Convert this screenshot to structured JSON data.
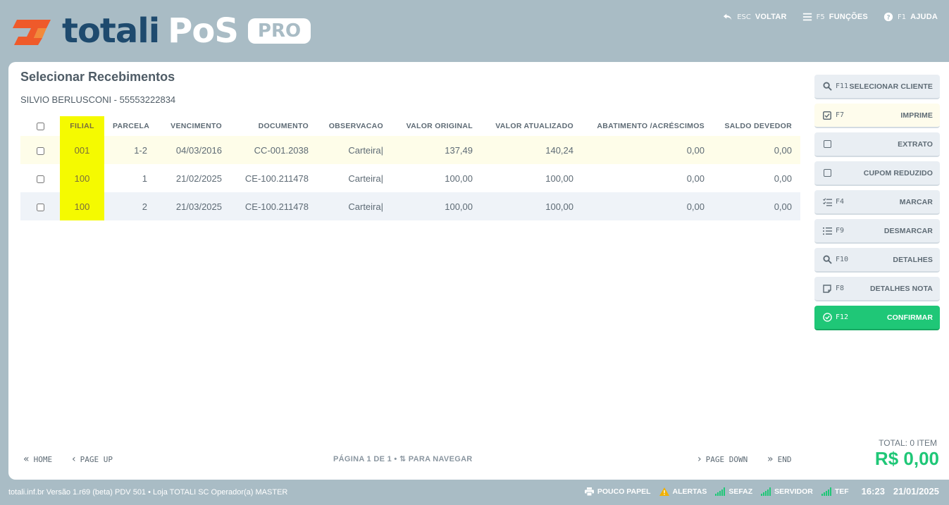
{
  "header": {
    "brand_part1": "totali",
    "brand_part2": "PoS",
    "brand_badge": "PRO",
    "actions": [
      {
        "key": "ESC",
        "label": "VOLTAR",
        "icon": "undo-icon"
      },
      {
        "key": "F5",
        "label": "FUNÇÕES",
        "icon": "menu-icon"
      },
      {
        "key": "F1",
        "label": "AJUDA",
        "icon": "help-icon"
      }
    ],
    "colors": {
      "brand_dark": "#1e4a6e",
      "brand_orange": "#ef5a2a",
      "background": "#a9bcc5"
    }
  },
  "main": {
    "title": "Selecionar Recebimentos",
    "customer": "SILVIO BERLUSCONI - 55553222834",
    "table": {
      "headers": [
        "FILIAL",
        "PARCELA",
        "VENCIMENTO",
        "DOCUMENTO",
        "OBSERVACAO",
        "VALOR ORIGINAL",
        "VALOR ATUALIZADO",
        "ABATIMENTO /ACRÉSCIMOS",
        "SALDO DEVEDOR"
      ],
      "rows": [
        {
          "filial": "001",
          "parcela": "1-2",
          "vencimento": "04/03/2016",
          "documento": "CC-001.2038",
          "observacao": "Carteira|",
          "valor_original": "137,49",
          "valor_atualizado": "140,24",
          "abatimento": "0,00",
          "saldo": "0,00"
        },
        {
          "filial": "100",
          "parcela": "1",
          "vencimento": "21/02/2025",
          "documento": "CE-100.211478",
          "observacao": "Carteira|",
          "valor_original": "100,00",
          "valor_atualizado": "100,00",
          "abatimento": "0,00",
          "saldo": "0,00"
        },
        {
          "filial": "100",
          "parcela": "2",
          "vencimento": "21/03/2025",
          "documento": "CE-100.211478",
          "observacao": "Carteira|",
          "valor_original": "100,00",
          "valor_atualizado": "100,00",
          "abatimento": "0,00",
          "saldo": "0,00"
        }
      ]
    },
    "nav": {
      "home": "HOME",
      "page_up": "PAGE UP",
      "page_down": "PAGE DOWN",
      "end": "END",
      "pager_prefix": "PÁGINA",
      "page": "1",
      "pager_of": "DE",
      "pages": "1",
      "pager_hint": "PARA NAVEGAR"
    },
    "total": {
      "label": "TOTAL: 0 ITEM",
      "value": "R$ 0,00",
      "color": "#1fc777"
    }
  },
  "sidebar": {
    "buttons": [
      {
        "key": "F11",
        "label": "SELECIONAR CLIENTE",
        "icon": "search-icon"
      },
      {
        "key": "F7",
        "label": "IMPRIME",
        "icon": "checkbox-checked-icon"
      },
      {
        "key": "",
        "label": "EXTRATO",
        "icon": "checkbox-icon"
      },
      {
        "key": "",
        "label": "CUPOM REDUZIDO",
        "icon": "checkbox-icon"
      },
      {
        "key": "F4",
        "label": "MARCAR",
        "icon": "checklist-icon"
      },
      {
        "key": "F9",
        "label": "DESMARCAR",
        "icon": "list-icon"
      },
      {
        "key": "F10",
        "label": "DETALHES",
        "icon": "search-icon"
      },
      {
        "key": "F8",
        "label": "DETALHES NOTA",
        "icon": "note-icon"
      },
      {
        "key": "F12",
        "label": "CONFIRMAR",
        "icon": "check-circle-icon"
      }
    ]
  },
  "statusbar": {
    "info": "totali.inf.br Versão 1.r69 (beta) PDV 501  •  Loja TOTALI SC Operador(a) MASTER",
    "items": [
      "POUCO PAPEL",
      "ALERTAS",
      "SEFAZ",
      "SERVIDOR",
      "TEF"
    ],
    "time": "16:23",
    "date": "21/01/2025"
  }
}
